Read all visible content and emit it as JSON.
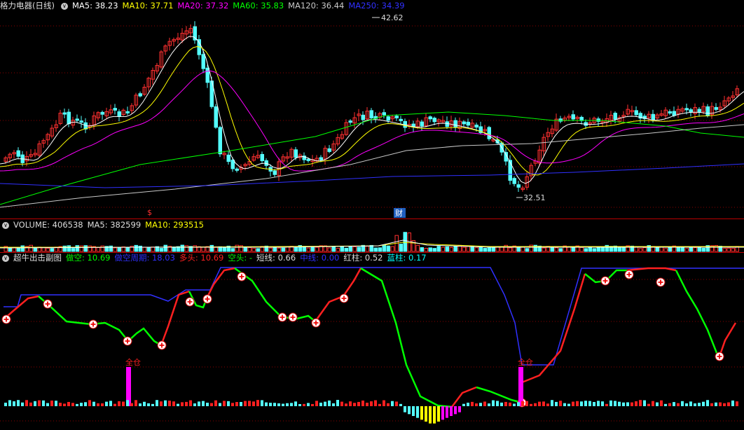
{
  "main": {
    "title": "格力电器(日线)",
    "ma": [
      {
        "label": "MA5: 38.23",
        "color": "#ffffff"
      },
      {
        "label": "MA10: 37.71",
        "color": "#ffff00"
      },
      {
        "label": "MA20: 37.32",
        "color": "#ff00ff"
      },
      {
        "label": "MA60: 35.83",
        "color": "#00ff00"
      },
      {
        "label": "MA120: 36.44",
        "color": "#c8c8c8"
      },
      {
        "label": "MA250: 34.39",
        "color": "#3030ff"
      }
    ],
    "high_label": "42.62",
    "low_label": "32.51",
    "marker_s": "$",
    "marker_cai": "财"
  },
  "volume": {
    "items": [
      {
        "label": "VOLUME: 406538",
        "color": "#dddddd"
      },
      {
        "label": "MA5: 382599",
        "color": "#dddddd"
      },
      {
        "label": "MA10: 293515",
        "color": "#ffff00"
      }
    ]
  },
  "indicator": {
    "items": [
      {
        "label": "超牛出击副图",
        "color": "#dddddd"
      },
      {
        "label": "做空: 10.69",
        "color": "#00ff00"
      },
      {
        "label": "做空周期: 18.03",
        "color": "#3030ff"
      },
      {
        "label": "多头: 10.69",
        "color": "#ff2020"
      },
      {
        "label": "空头: -",
        "color": "#00ff00"
      },
      {
        "label": "短线: 0.66",
        "color": "#dddddd"
      },
      {
        "label": "中线: 0.00",
        "color": "#3030ff"
      },
      {
        "label": "红柱: 0.52",
        "color": "#dddddd"
      },
      {
        "label": "蓝柱: 0.17",
        "color": "#00ffff"
      }
    ],
    "full_label": "全仓"
  },
  "colors": {
    "up": "#ff3030",
    "down": "#54ffff",
    "grid": "#8b0000",
    "ma5": "#ffffff",
    "ma10": "#ffff00",
    "ma20": "#ff00ff",
    "ma60": "#00ff00",
    "ma120": "#c8c8c8",
    "ma250": "#3030ff"
  }
}
